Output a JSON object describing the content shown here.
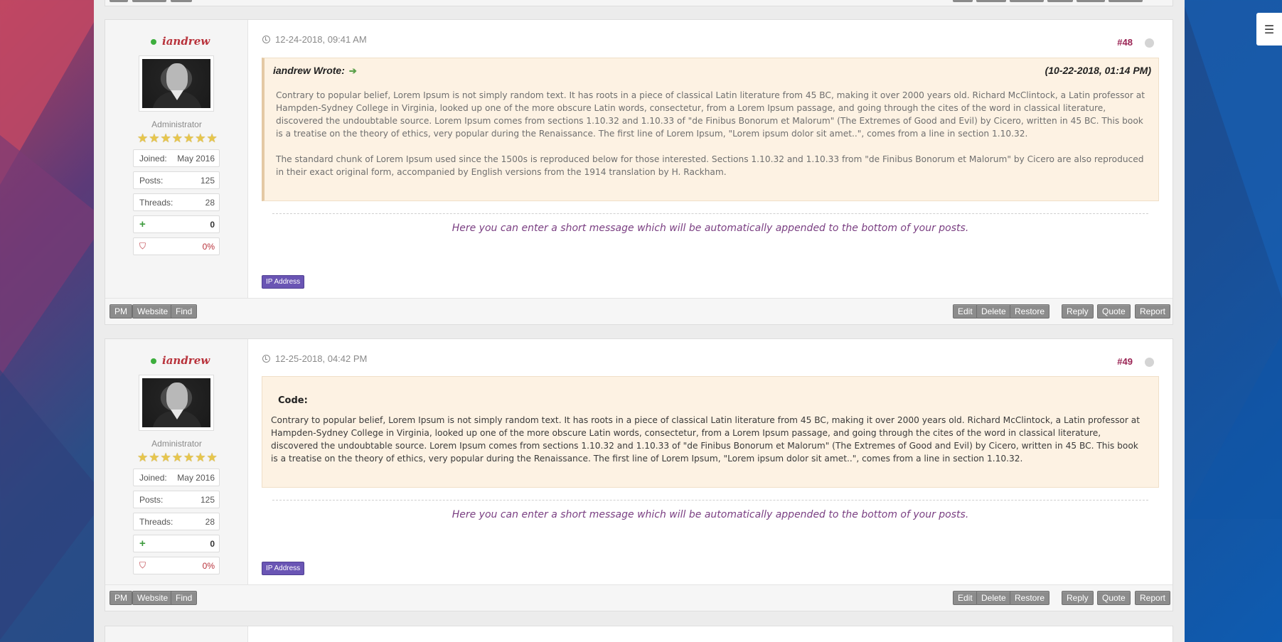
{
  "menu": {
    "icon": "☰"
  },
  "posts": [
    {
      "author": {
        "name": "iandrew",
        "role": "Administrator",
        "stars": [
          "★",
          "★",
          "★",
          "★",
          "★",
          "★",
          "★"
        ],
        "joined_label": "Joined:",
        "joined": "May 2016",
        "posts_label": "Posts:",
        "posts": "125",
        "threads_label": "Threads:",
        "threads": "28",
        "rep_icon": "+",
        "reputation": "0",
        "warn_icon": "⛉",
        "warning": "0%"
      },
      "date": "12-24-2018, 09:41 AM",
      "number": "#48",
      "quote": {
        "author": "iandrew Wrote:",
        "arrow": "➔",
        "date": "(10-22-2018, 01:14 PM)",
        "p1": "Contrary to popular belief, Lorem Ipsum is not simply random text. It has roots in a piece of classical Latin literature from 45 BC, making it over 2000 years old. Richard McClintock, a Latin professor at Hampden-Sydney College in Virginia, looked up one of the more obscure Latin words, consectetur, from a Lorem Ipsum passage, and going through the cites of the word in classical literature, discovered the undoubtable source. Lorem Ipsum comes from sections 1.10.32 and 1.10.33 of \"de Finibus Bonorum et Malorum\" (The Extremes of Good and Evil) by Cicero, written in 45 BC. This book is a treatise on the theory of ethics, very popular during the Renaissance. The first line of Lorem Ipsum, \"Lorem ipsum dolor sit amet..\", comes from a line in section 1.10.32.",
        "p2": "The standard chunk of Lorem Ipsum used since the 1500s is reproduced below for those interested. Sections 1.10.32 and 1.10.33 from \"de Finibus Bonorum et Malorum\" by Cicero are also reproduced in their exact original form, accompanied by English versions from the 1914 translation by H. Rackham."
      },
      "signature": "Here you can enter a short message which will be automatically appended to the bottom of your posts.",
      "ip_label": "IP Address"
    },
    {
      "author": {
        "name": "iandrew",
        "role": "Administrator",
        "stars": [
          "★",
          "★",
          "★",
          "★",
          "★",
          "★",
          "★"
        ],
        "joined_label": "Joined:",
        "joined": "May 2016",
        "posts_label": "Posts:",
        "posts": "125",
        "threads_label": "Threads:",
        "threads": "28",
        "rep_icon": "+",
        "reputation": "0",
        "warn_icon": "⛉",
        "warning": "0%"
      },
      "date": "12-25-2018, 04:42 PM",
      "number": "#49",
      "code": {
        "label": "Code:",
        "text": "Contrary to popular belief, Lorem Ipsum is not simply random text. It has roots in a piece of classical Latin literature from 45 BC, making it over 2000 years old. Richard McClintock, a Latin professor at Hampden-Sydney College in Virginia, looked up one of the more obscure Latin words, consectetur, from a Lorem Ipsum passage, and going through the cites of the word in classical literature, discovered the undoubtable source. Lorem Ipsum comes from sections 1.10.32 and 1.10.33 of \"de Finibus Bonorum et Malorum\" (The Extremes of Good and Evil) by Cicero, written in 45 BC. This book is a treatise on the theory of ethics, very popular during the Renaissance. The first line of Lorem Ipsum, \"Lorem ipsum dolor sit amet..\", comes from a line in section 1.10.32."
      },
      "signature": "Here you can enter a short message which will be automatically appended to the bottom of your posts.",
      "ip_label": "IP Address"
    }
  ],
  "footer_buttons": {
    "pm": "PM",
    "website": "Website",
    "find": "Find",
    "edit": "Edit",
    "delete": "Delete",
    "restore": "Restore",
    "reply": "Reply",
    "quote": "Quote",
    "report": "Report"
  },
  "colors": {
    "username": "#b8323b",
    "post_number": "#9a2454",
    "signature": "#7a3f82",
    "ip_button": "#6a55b4",
    "quote_bg": "#fdf2e3"
  }
}
